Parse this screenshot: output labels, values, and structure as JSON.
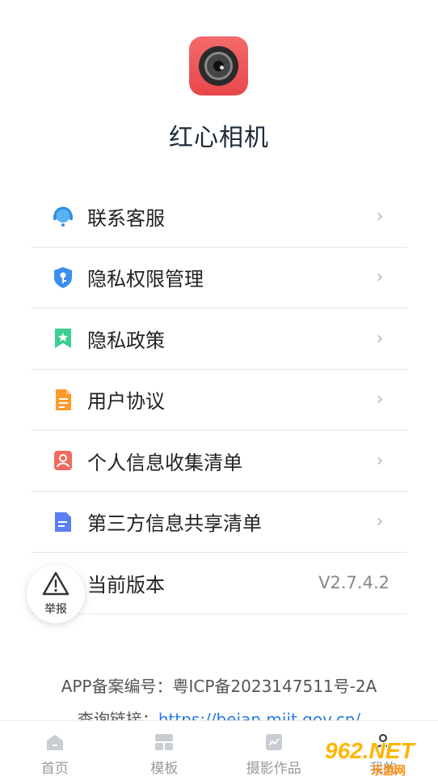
{
  "app": {
    "name": "红心相机"
  },
  "menu": {
    "items": [
      {
        "label": "联系客服",
        "icon": "customer-service-icon"
      },
      {
        "label": "隐私权限管理",
        "icon": "shield-key-icon"
      },
      {
        "label": "隐私政策",
        "icon": "bookmark-star-icon"
      },
      {
        "label": "用户协议",
        "icon": "document-icon"
      },
      {
        "label": "个人信息收集清单",
        "icon": "person-card-icon"
      },
      {
        "label": "第三方信息共享清单",
        "icon": "list-doc-icon"
      }
    ],
    "version_label": "当前版本",
    "version_value": "V2.7.4.2"
  },
  "report": {
    "label": "举报"
  },
  "footer": {
    "icp": "APP备案编号：粤ICP备2023147511号-2A",
    "query_prefix": "查询链接：",
    "query_link": "https://beian.miit.gov.cn/"
  },
  "tabbar": {
    "tabs": [
      {
        "label": "首页"
      },
      {
        "label": "模板"
      },
      {
        "label": "摄影作品"
      },
      {
        "label": "我的"
      }
    ]
  },
  "watermark": {
    "main": "962.NET",
    "sub": "乐游网"
  },
  "colors": {
    "accent": "#2c7be5",
    "logo": "#e8474b"
  }
}
